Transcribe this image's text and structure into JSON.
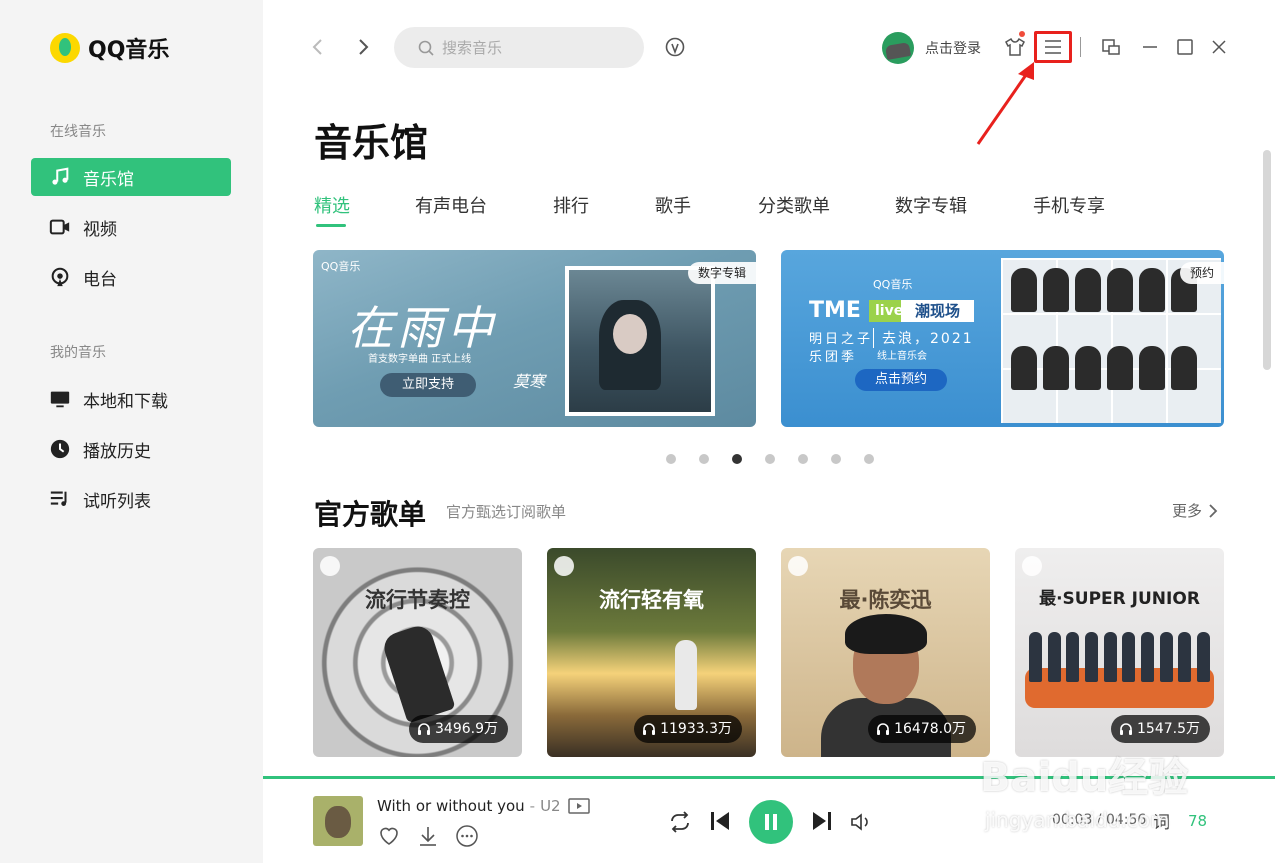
{
  "app": {
    "logo_text": "QQ音乐"
  },
  "sidebar": {
    "section_online": "在线音乐",
    "online_items": [
      {
        "label": "音乐馆",
        "icon": "music-note-icon",
        "active": true
      },
      {
        "label": "视频",
        "icon": "video-icon",
        "active": false
      },
      {
        "label": "电台",
        "icon": "radio-icon",
        "active": false
      }
    ],
    "section_mine": "我的音乐",
    "mine_items": [
      {
        "label": "本地和下载",
        "icon": "computer-icon"
      },
      {
        "label": "播放历史",
        "icon": "history-icon"
      },
      {
        "label": "试听列表",
        "icon": "playlist-icon"
      }
    ]
  },
  "topbar": {
    "search_placeholder": "搜索音乐",
    "login_label": "点击登录"
  },
  "page": {
    "title": "音乐馆",
    "tabs": [
      "精选",
      "有声电台",
      "排行",
      "歌手",
      "分类歌单",
      "数字专辑",
      "手机专享"
    ],
    "active_tab": 0
  },
  "banners": [
    {
      "tag": "数字专辑",
      "brand": "QQ音乐",
      "script_title": "在雨中",
      "subtitle": "首支数字单曲 正式上线",
      "button": "立即支持",
      "signature": "莫寒"
    },
    {
      "tag": "预约",
      "brand": "QQ音乐",
      "logo": "TME",
      "live": "live",
      "headline": "潮现场",
      "line1": "明日之子",
      "line2": "乐团季",
      "line3": "去浪，2021",
      "line4": "线上音乐会",
      "button": "点击预约"
    }
  ],
  "carousel": {
    "count": 7,
    "active": 2
  },
  "playlists": {
    "title": "官方歌单",
    "subtitle": "官方甄选订阅歌单",
    "more": "更多",
    "items": [
      {
        "cover_title": "流行节奏控",
        "plays": "3496.9万"
      },
      {
        "cover_title": "流行轻有氧",
        "plays": "11933.3万"
      },
      {
        "cover_title": "最·陈奕迅",
        "plays": "16478.0万"
      },
      {
        "cover_title": "最·SUPER JUNIOR",
        "plays": "1547.5万"
      }
    ]
  },
  "player": {
    "song": "With or without you",
    "separator": "-",
    "artist": "U2",
    "time": "00:03 / 04:56",
    "lyric_label": "词",
    "count": "78",
    "progress": 0.01
  },
  "watermark": {
    "main": "Baidu经验",
    "sub": "jingyan.baidu.com"
  },
  "colors": {
    "accent": "#31c27c",
    "highlight": "#e8211d"
  }
}
